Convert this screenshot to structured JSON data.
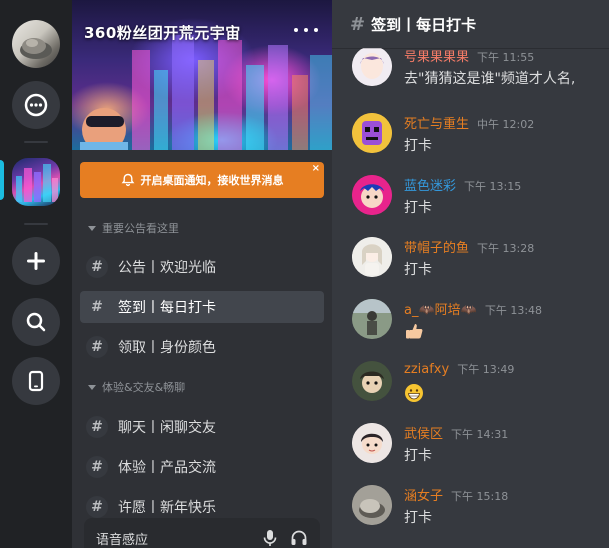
{
  "server": {
    "banner_title": "360粉丝团开荒元宇宙",
    "notice": "开启桌面通知，接收世界消息",
    "notice_close": "×"
  },
  "categories": [
    {
      "label": "重要公告看这里"
    },
    {
      "label": "体验&交友&畅聊"
    }
  ],
  "channels": [
    {
      "label": "公告丨欢迎光临",
      "active": false
    },
    {
      "label": "签到丨每日打卡",
      "active": true
    },
    {
      "label": "领取丨身份颜色",
      "active": false
    },
    {
      "label": "聊天丨闲聊交友",
      "active": false
    },
    {
      "label": "体验丨产品交流",
      "active": false
    },
    {
      "label": "许愿丨新年快乐",
      "active": false
    }
  ],
  "voice_bar": {
    "label": "语音感应"
  },
  "chat": {
    "header_hash": "#",
    "header_title": "签到丨每日打卡",
    "messages": [
      {
        "name": "号果果果果",
        "time": "下午 11:55",
        "text": "去\"猜猜这是谁\"频道才人名,",
        "name_color": "#f47b67",
        "avatar": "girl-avatar"
      },
      {
        "name": "死亡与重生",
        "time": "中午 12:02",
        "text": "打卡",
        "name_color": "#e67e22",
        "avatar": "purple-robot-avatar"
      },
      {
        "name": "蓝色迷彩",
        "time": "下午 13:15",
        "text": "打卡",
        "name_color": "#3498db",
        "avatar": "pink-face-avatar"
      },
      {
        "name": "带帽子的鱼",
        "time": "下午 13:28",
        "text": "打卡",
        "name_color": "#e67e22",
        "avatar": "anime-girl-avatar"
      },
      {
        "name": "a_🦇阿培🦇",
        "time": "下午 13:48",
        "text": "",
        "emoji": "thumbs-up-emoji",
        "name_color": "#e67e22",
        "avatar": "photo-avatar"
      },
      {
        "name": "zziafxy",
        "time": "下午 13:49",
        "text": "",
        "emoji": "grin-emoji",
        "name_color": "#e67e22",
        "avatar": "cartoon-avatar"
      },
      {
        "name": "武侯区",
        "time": "下午 14:31",
        "text": "打卡",
        "name_color": "#e67e22",
        "avatar": "doll-avatar"
      },
      {
        "name": "涵女子",
        "time": "下午 15:18",
        "text": "打卡",
        "name_color": "#e67e22",
        "avatar": "rock-avatar"
      }
    ]
  },
  "colors": {
    "accent_orange": "#e67e22",
    "rail_active_indicator": "#1bbde0",
    "background": "#36393f",
    "sidebar": "#2f3136",
    "rail": "#202225"
  }
}
